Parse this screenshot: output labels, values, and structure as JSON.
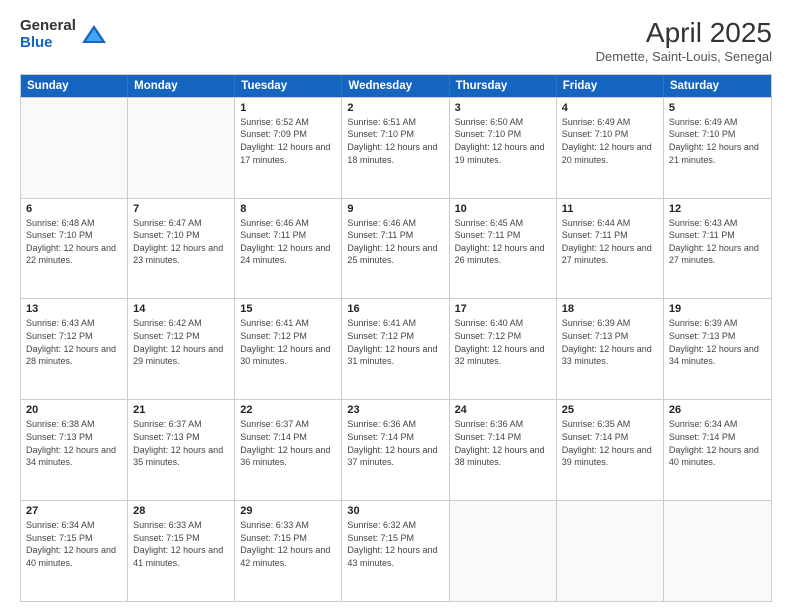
{
  "header": {
    "logo_general": "General",
    "logo_blue": "Blue",
    "title": "April 2025",
    "subtitle": "Demette, Saint-Louis, Senegal"
  },
  "days_of_week": [
    "Sunday",
    "Monday",
    "Tuesday",
    "Wednesday",
    "Thursday",
    "Friday",
    "Saturday"
  ],
  "weeks": [
    [
      {
        "day": "",
        "info": ""
      },
      {
        "day": "",
        "info": ""
      },
      {
        "day": "1",
        "info": "Sunrise: 6:52 AM\nSunset: 7:09 PM\nDaylight: 12 hours and 17 minutes."
      },
      {
        "day": "2",
        "info": "Sunrise: 6:51 AM\nSunset: 7:10 PM\nDaylight: 12 hours and 18 minutes."
      },
      {
        "day": "3",
        "info": "Sunrise: 6:50 AM\nSunset: 7:10 PM\nDaylight: 12 hours and 19 minutes."
      },
      {
        "day": "4",
        "info": "Sunrise: 6:49 AM\nSunset: 7:10 PM\nDaylight: 12 hours and 20 minutes."
      },
      {
        "day": "5",
        "info": "Sunrise: 6:49 AM\nSunset: 7:10 PM\nDaylight: 12 hours and 21 minutes."
      }
    ],
    [
      {
        "day": "6",
        "info": "Sunrise: 6:48 AM\nSunset: 7:10 PM\nDaylight: 12 hours and 22 minutes."
      },
      {
        "day": "7",
        "info": "Sunrise: 6:47 AM\nSunset: 7:10 PM\nDaylight: 12 hours and 23 minutes."
      },
      {
        "day": "8",
        "info": "Sunrise: 6:46 AM\nSunset: 7:11 PM\nDaylight: 12 hours and 24 minutes."
      },
      {
        "day": "9",
        "info": "Sunrise: 6:46 AM\nSunset: 7:11 PM\nDaylight: 12 hours and 25 minutes."
      },
      {
        "day": "10",
        "info": "Sunrise: 6:45 AM\nSunset: 7:11 PM\nDaylight: 12 hours and 26 minutes."
      },
      {
        "day": "11",
        "info": "Sunrise: 6:44 AM\nSunset: 7:11 PM\nDaylight: 12 hours and 27 minutes."
      },
      {
        "day": "12",
        "info": "Sunrise: 6:43 AM\nSunset: 7:11 PM\nDaylight: 12 hours and 27 minutes."
      }
    ],
    [
      {
        "day": "13",
        "info": "Sunrise: 6:43 AM\nSunset: 7:12 PM\nDaylight: 12 hours and 28 minutes."
      },
      {
        "day": "14",
        "info": "Sunrise: 6:42 AM\nSunset: 7:12 PM\nDaylight: 12 hours and 29 minutes."
      },
      {
        "day": "15",
        "info": "Sunrise: 6:41 AM\nSunset: 7:12 PM\nDaylight: 12 hours and 30 minutes."
      },
      {
        "day": "16",
        "info": "Sunrise: 6:41 AM\nSunset: 7:12 PM\nDaylight: 12 hours and 31 minutes."
      },
      {
        "day": "17",
        "info": "Sunrise: 6:40 AM\nSunset: 7:12 PM\nDaylight: 12 hours and 32 minutes."
      },
      {
        "day": "18",
        "info": "Sunrise: 6:39 AM\nSunset: 7:13 PM\nDaylight: 12 hours and 33 minutes."
      },
      {
        "day": "19",
        "info": "Sunrise: 6:39 AM\nSunset: 7:13 PM\nDaylight: 12 hours and 34 minutes."
      }
    ],
    [
      {
        "day": "20",
        "info": "Sunrise: 6:38 AM\nSunset: 7:13 PM\nDaylight: 12 hours and 34 minutes."
      },
      {
        "day": "21",
        "info": "Sunrise: 6:37 AM\nSunset: 7:13 PM\nDaylight: 12 hours and 35 minutes."
      },
      {
        "day": "22",
        "info": "Sunrise: 6:37 AM\nSunset: 7:14 PM\nDaylight: 12 hours and 36 minutes."
      },
      {
        "day": "23",
        "info": "Sunrise: 6:36 AM\nSunset: 7:14 PM\nDaylight: 12 hours and 37 minutes."
      },
      {
        "day": "24",
        "info": "Sunrise: 6:36 AM\nSunset: 7:14 PM\nDaylight: 12 hours and 38 minutes."
      },
      {
        "day": "25",
        "info": "Sunrise: 6:35 AM\nSunset: 7:14 PM\nDaylight: 12 hours and 39 minutes."
      },
      {
        "day": "26",
        "info": "Sunrise: 6:34 AM\nSunset: 7:14 PM\nDaylight: 12 hours and 40 minutes."
      }
    ],
    [
      {
        "day": "27",
        "info": "Sunrise: 6:34 AM\nSunset: 7:15 PM\nDaylight: 12 hours and 40 minutes."
      },
      {
        "day": "28",
        "info": "Sunrise: 6:33 AM\nSunset: 7:15 PM\nDaylight: 12 hours and 41 minutes."
      },
      {
        "day": "29",
        "info": "Sunrise: 6:33 AM\nSunset: 7:15 PM\nDaylight: 12 hours and 42 minutes."
      },
      {
        "day": "30",
        "info": "Sunrise: 6:32 AM\nSunset: 7:15 PM\nDaylight: 12 hours and 43 minutes."
      },
      {
        "day": "",
        "info": ""
      },
      {
        "day": "",
        "info": ""
      },
      {
        "day": "",
        "info": ""
      }
    ]
  ]
}
